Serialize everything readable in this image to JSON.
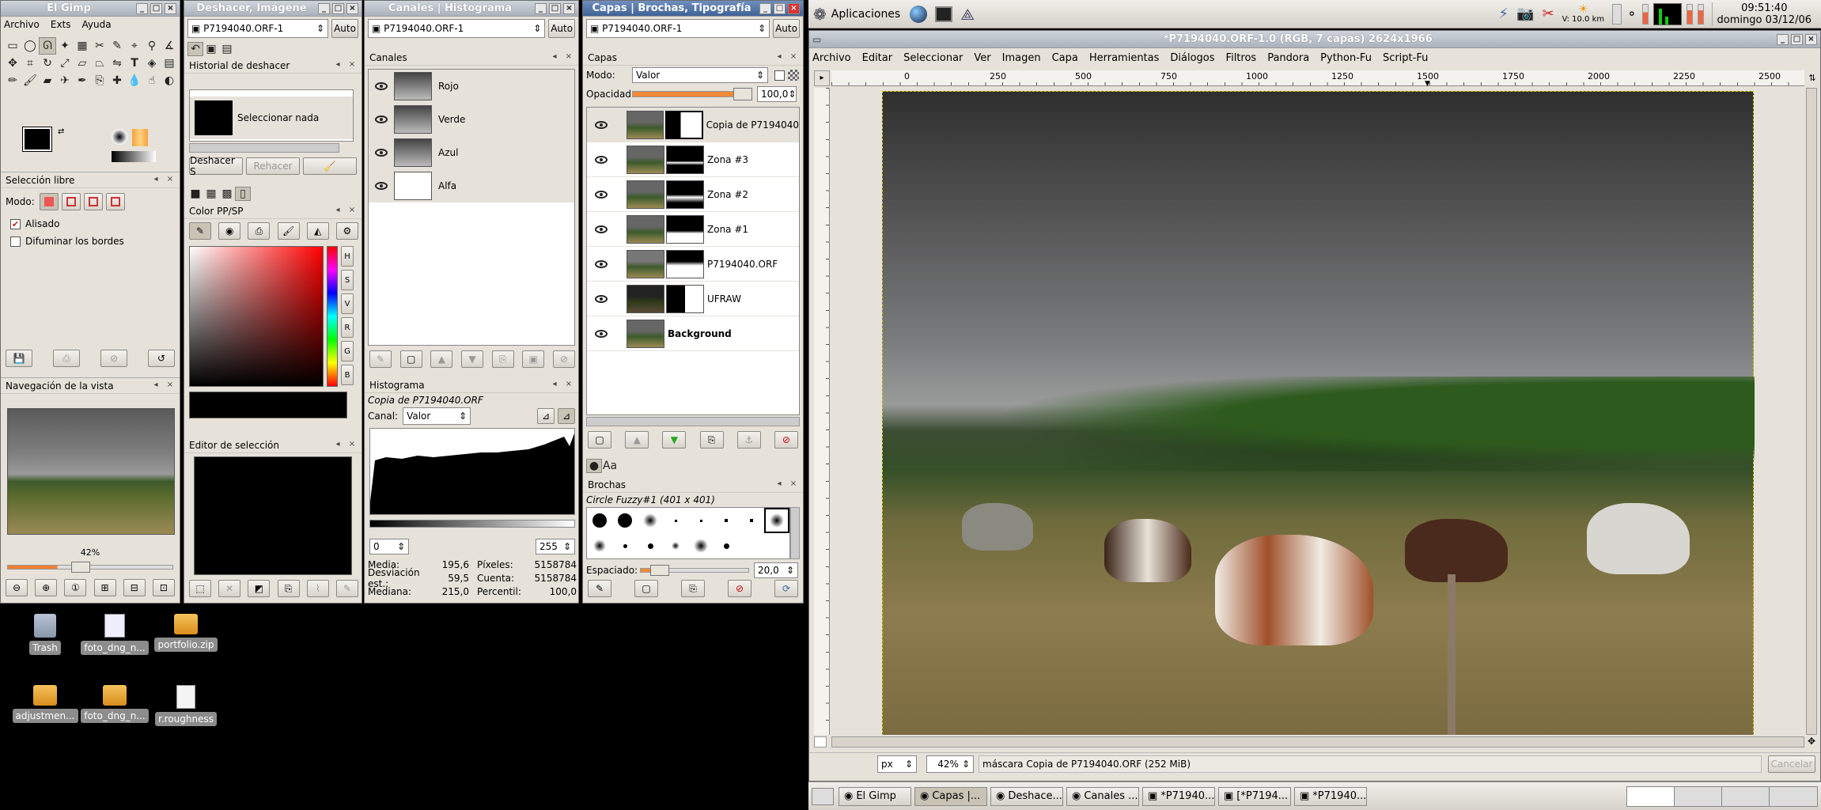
{
  "toolbox": {
    "title": "El Gimp",
    "menu": [
      "Archivo",
      "Exts",
      "Ayuda"
    ],
    "tool_options_title": "Selección libre",
    "mode_label": "Modo:",
    "antialias_label": "Alisado",
    "feather_label": "Difuminar los bordes",
    "navigation_title": "Navegación de la vista",
    "zoom_label": "42%"
  },
  "undo_window": {
    "title": "Deshacer, Imágene",
    "image_combo": "P7194040.ORF-1",
    "auto_label": "Auto",
    "history_title": "Historial de deshacer",
    "history_item": "Seleccionar nada",
    "undo_button": "Deshacer S",
    "redo_button": "Rehacer",
    "color_title": "Color PP/SP",
    "selection_editor_title": "Editor de selección",
    "hsv_labels": [
      "H",
      "S",
      "V",
      "R",
      "G",
      "B"
    ]
  },
  "channels_window": {
    "title": "Canales | Histograma",
    "image_combo": "P7194040.ORF-1",
    "auto_label": "Auto",
    "channels_title": "Canales",
    "channels": [
      "Rojo",
      "Verde",
      "Azul",
      "Alfa"
    ],
    "histogram_title": "Histograma",
    "histogram_layer": "Copia de P7194040.ORF",
    "channel_label": "Canal:",
    "channel_value": "Valor",
    "range_min": "0",
    "range_max": "255",
    "stats": [
      {
        "label": "Media:",
        "value": "195,6",
        "label2": "Píxeles:",
        "value2": "5158784"
      },
      {
        "label": "Desviación est.:",
        "value": "59,5",
        "label2": "Cuenta:",
        "value2": "5158784"
      },
      {
        "label": "Mediana:",
        "value": "215,0",
        "label2": "Percentil:",
        "value2": "100,0"
      }
    ]
  },
  "layers_window": {
    "title": "Capas | Brochas, Tipografía",
    "image_combo": "P7194040.ORF-1",
    "auto_label": "Auto",
    "layers_title": "Capas",
    "mode_label": "Modo:",
    "mode_value": "Valor",
    "opacity_label": "Opacidad:",
    "opacity_value": "100,0",
    "layers": [
      "Copia de P7194040",
      "Zona #3",
      "Zona #2",
      "Zona #1",
      "P7194040.ORF",
      "UFRAW",
      "Background"
    ],
    "brushes_title": "Brochas",
    "brush_name": "Circle Fuzzy#1 (401 x 401)",
    "spacing_label": "Espaciado:",
    "spacing_value": "20,0"
  },
  "image_window": {
    "title": "*P7194040.ORF-1.0 (RGB, 7 capas) 2624x1966",
    "menu": [
      "Archivo",
      "Editar",
      "Seleccionar",
      "Ver",
      "Imagen",
      "Capa",
      "Herramientas",
      "Diálogos",
      "Filtros",
      "Pandora",
      "Python-Fu",
      "Script-Fu"
    ],
    "ruler_ticks": [
      "0",
      "250",
      "500",
      "750",
      "1000",
      "1250",
      "1500",
      "1750",
      "2000",
      "2250",
      "2500"
    ],
    "unit": "px",
    "zoom": "42%",
    "status": "máscara Copia de P7194040.ORF (252 MiB)",
    "cancel": "Cancelar"
  },
  "top_panel": {
    "apps_label": "Aplicaciones",
    "weather": "V: 10.0 km",
    "time": "09:51:40",
    "date": "domingo 03/12/06"
  },
  "desktop_icons": [
    "Trash",
    "foto_dng_n...",
    "portfolio.zip",
    "adjustmen...",
    "foto_dng_n...",
    "r.roughness"
  ],
  "taskbar": [
    "El Gimp",
    "Capas |...",
    "Deshace...",
    "Canales ...",
    "*P71940...",
    "[*P7194...",
    "*P71940..."
  ]
}
